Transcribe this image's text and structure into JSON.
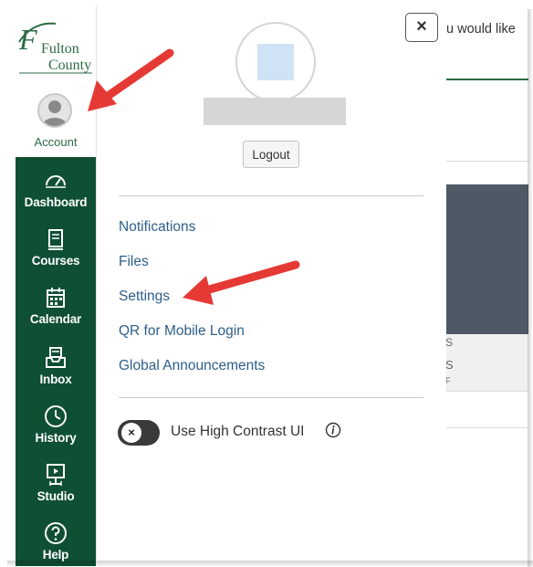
{
  "logo": {
    "line1": "Fulton",
    "line2": "County"
  },
  "account": {
    "label": "Account"
  },
  "nav": {
    "items": [
      {
        "label": "Dashboard",
        "icon": "dashboard-icon"
      },
      {
        "label": "Courses",
        "icon": "courses-icon"
      },
      {
        "label": "Calendar",
        "icon": "calendar-icon"
      },
      {
        "label": "Inbox",
        "icon": "inbox-icon"
      },
      {
        "label": "History",
        "icon": "history-icon"
      },
      {
        "label": "Studio",
        "icon": "studio-icon"
      },
      {
        "label": "Help",
        "icon": "help-icon"
      }
    ]
  },
  "tray": {
    "close_label": "×",
    "logout_label": "Logout",
    "links": [
      "Notifications",
      "Files",
      "Settings",
      "QR for Mobile Login",
      "Global Announcements"
    ],
    "high_contrast_label": "Use High Contrast UI",
    "toggle_knob": "×"
  },
  "background_page": {
    "text": "u would like",
    "char1": "S",
    "char2": "S",
    "char3": "F"
  },
  "colors": {
    "nav_dark": "#0f4f34",
    "link": "#2d5e8a",
    "arrow": "#e53935",
    "logo_green": "#2d6a44"
  }
}
